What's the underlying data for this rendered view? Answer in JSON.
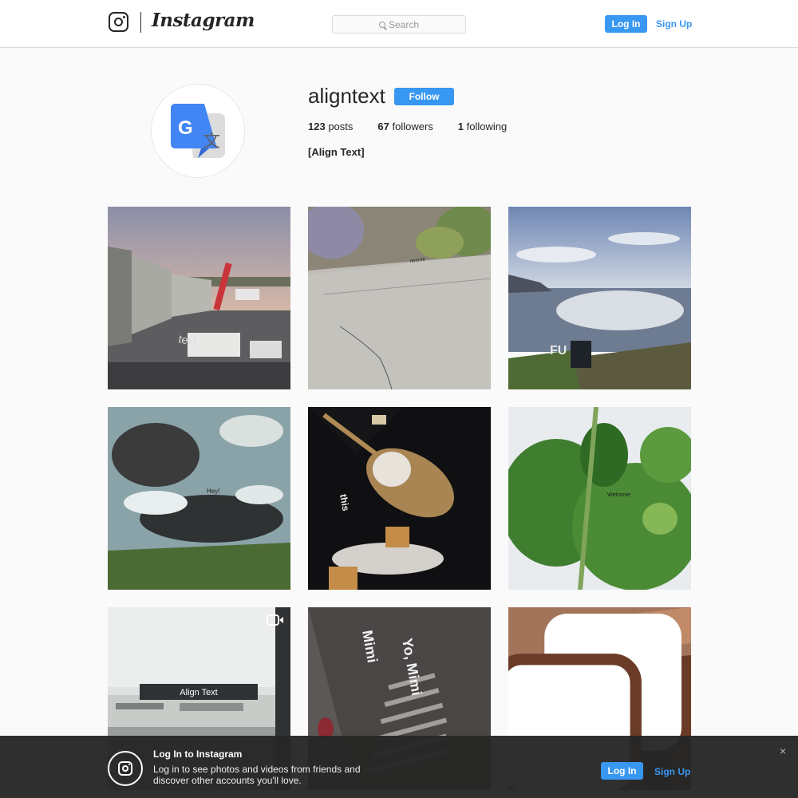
{
  "header": {
    "brand": "Instagram",
    "search_placeholder": "Search",
    "login_label": "Log In",
    "signup_label": "Sign Up"
  },
  "profile": {
    "username": "aligntext",
    "follow_label": "Follow",
    "posts_count": "123",
    "posts_label": " posts",
    "followers_count": "67",
    "followers_label": " followers",
    "following_count": "1",
    "following_label": " following",
    "full_name": "[Align Text]"
  },
  "posts": [
    {
      "scene": "airport-gate-sunset",
      "overlay_text": "text"
    },
    {
      "scene": "sidewalk-lavender",
      "overlay_text": "next kit"
    },
    {
      "scene": "ocean-cliff-person",
      "overlay_text": "FU"
    },
    {
      "scene": "rocky-surf",
      "overlay_text": "Hey!"
    },
    {
      "scene": "spoon-milk-cereal",
      "overlay_text": "this"
    },
    {
      "scene": "parsley-leaves",
      "overlay_text": "Welcome"
    },
    {
      "scene": "runway-window",
      "overlay_text": "Align Text",
      "badge": "video-icon"
    },
    {
      "scene": "wall-shadows",
      "overlay_text_1": "Mimi",
      "overlay_text_2": "Yo, Mimi"
    },
    {
      "scene": "airplane-cabin",
      "badge": "multiple-posts-icon"
    }
  ],
  "login_bar": {
    "title": "Log In to Instagram",
    "text": "Log in to see photos and videos from friends and discover other accounts you'll love.",
    "login_label": "Log In",
    "signup_label": "Sign Up",
    "close_glyph": "×"
  },
  "colors": {
    "accent": "#3897f0",
    "text": "#262626",
    "background": "#fafafa"
  }
}
